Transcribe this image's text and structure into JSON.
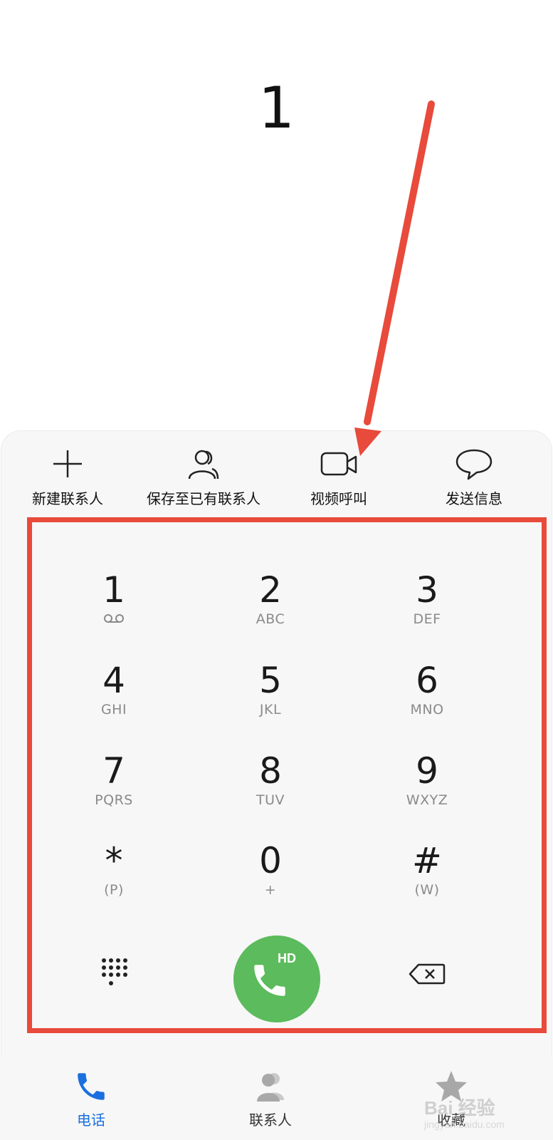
{
  "dialed_number": "1",
  "actions": [
    {
      "icon": "plus-icon",
      "label": "新建联系人"
    },
    {
      "icon": "person-group-icon",
      "label": "保存至已有联系人"
    },
    {
      "icon": "video-camera-icon",
      "label": "视频呼叫"
    },
    {
      "icon": "speech-bubble-icon",
      "label": "发送信息"
    }
  ],
  "keys": [
    {
      "digit": "1",
      "letters": ""
    },
    {
      "digit": "2",
      "letters": "ABC"
    },
    {
      "digit": "3",
      "letters": "DEF"
    },
    {
      "digit": "4",
      "letters": "GHI"
    },
    {
      "digit": "5",
      "letters": "JKL"
    },
    {
      "digit": "6",
      "letters": "MNO"
    },
    {
      "digit": "7",
      "letters": "PQRS"
    },
    {
      "digit": "8",
      "letters": "TUV"
    },
    {
      "digit": "9",
      "letters": "WXYZ"
    },
    {
      "digit": "*",
      "letters": "(P)"
    },
    {
      "digit": "0",
      "letters": "+"
    },
    {
      "digit": "#",
      "letters": "(W)"
    }
  ],
  "call_button": {
    "badge": "HD",
    "color": "#5cbb5c"
  },
  "bottom_nav": [
    {
      "icon": "phone-icon",
      "label": "电话",
      "active": true
    },
    {
      "icon": "contacts-icon",
      "label": "联系人",
      "active": false
    },
    {
      "icon": "star-icon",
      "label": "收藏",
      "active": false
    }
  ],
  "colors": {
    "accent": "#1a6fe0",
    "annotation": "#e84a3b",
    "call": "#5cbb5c"
  },
  "watermark": {
    "text": "Bai 经验",
    "sub": "jingyan.baidu.com"
  }
}
